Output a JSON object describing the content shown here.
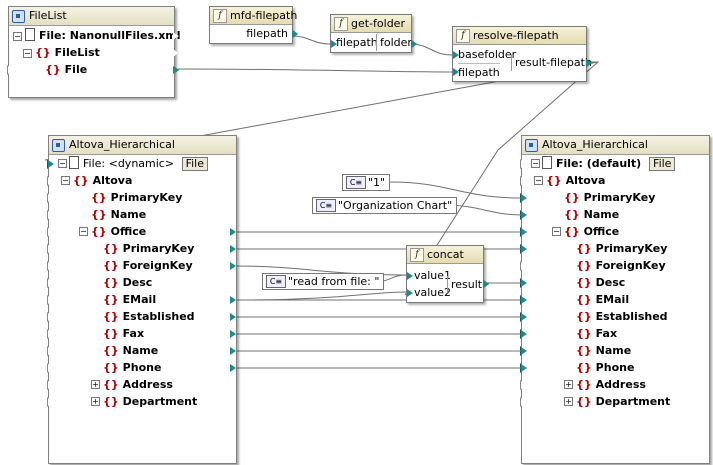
{
  "filelist": {
    "title": "FileList",
    "file_label": "File: NanonullFiles.xml",
    "root": "FileList",
    "child": "File"
  },
  "functions": {
    "mfd_filepath": {
      "title": "mfd-filepath",
      "out": "filepath"
    },
    "get_folder": {
      "title": "get-folder",
      "in": "filepath",
      "out": "folder"
    },
    "resolve_filepath": {
      "title": "resolve-filepath",
      "in1": "basefolder",
      "in2": "filepath",
      "out": "result-filepath"
    },
    "concat": {
      "title": "concat",
      "in1": "value1",
      "in2": "value2",
      "out": "result"
    }
  },
  "constants": {
    "c1": "\"1\"",
    "c2": "\"Organization Chart\"",
    "c3": "\"read from file: \"",
    "icon_label": "C≡"
  },
  "source": {
    "title": "Altova_Hierarchical",
    "file_label": "File: <dynamic>",
    "file_button": "File",
    "items": [
      "Altova",
      "PrimaryKey",
      "Name",
      "Office",
      "PrimaryKey",
      "ForeignKey",
      "Desc",
      "EMail",
      "Established",
      "Fax",
      "Name",
      "Phone",
      "Address",
      "Department"
    ]
  },
  "target": {
    "title": "Altova_Hierarchical",
    "file_label": "File: (default)",
    "file_button": "File",
    "items": [
      "Altova",
      "PrimaryKey",
      "Name",
      "Office",
      "PrimaryKey",
      "ForeignKey",
      "Desc",
      "EMail",
      "Established",
      "Fax",
      "Name",
      "Phone",
      "Address",
      "Department"
    ]
  },
  "icons": {
    "element": "element-brace-icon",
    "file": "file-icon",
    "function": "function-icon",
    "constant": "constant-icon"
  },
  "colors": {
    "wire": "#707070",
    "pin_connected": "#1f8a8a",
    "title_bar": "#e3dfc2"
  }
}
